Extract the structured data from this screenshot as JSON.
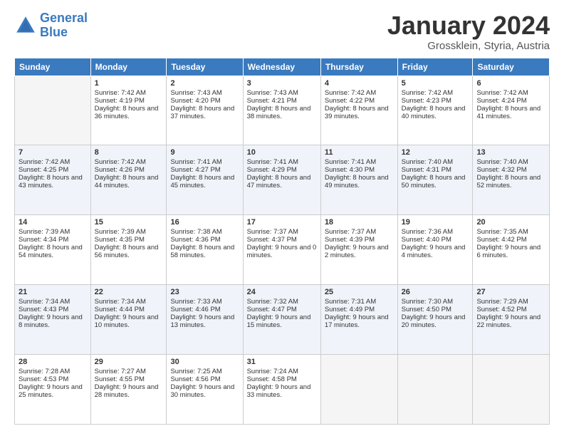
{
  "logo": {
    "line1": "General",
    "line2": "Blue"
  },
  "header": {
    "month": "January 2024",
    "location": "Grossklein, Styria, Austria"
  },
  "weekdays": [
    "Sunday",
    "Monday",
    "Tuesday",
    "Wednesday",
    "Thursday",
    "Friday",
    "Saturday"
  ],
  "weeks": [
    [
      {
        "day": "",
        "sunrise": "",
        "sunset": "",
        "daylight": ""
      },
      {
        "day": "1",
        "sunrise": "Sunrise: 7:42 AM",
        "sunset": "Sunset: 4:19 PM",
        "daylight": "Daylight: 8 hours and 36 minutes."
      },
      {
        "day": "2",
        "sunrise": "Sunrise: 7:43 AM",
        "sunset": "Sunset: 4:20 PM",
        "daylight": "Daylight: 8 hours and 37 minutes."
      },
      {
        "day": "3",
        "sunrise": "Sunrise: 7:43 AM",
        "sunset": "Sunset: 4:21 PM",
        "daylight": "Daylight: 8 hours and 38 minutes."
      },
      {
        "day": "4",
        "sunrise": "Sunrise: 7:42 AM",
        "sunset": "Sunset: 4:22 PM",
        "daylight": "Daylight: 8 hours and 39 minutes."
      },
      {
        "day": "5",
        "sunrise": "Sunrise: 7:42 AM",
        "sunset": "Sunset: 4:23 PM",
        "daylight": "Daylight: 8 hours and 40 minutes."
      },
      {
        "day": "6",
        "sunrise": "Sunrise: 7:42 AM",
        "sunset": "Sunset: 4:24 PM",
        "daylight": "Daylight: 8 hours and 41 minutes."
      }
    ],
    [
      {
        "day": "7",
        "sunrise": "Sunrise: 7:42 AM",
        "sunset": "Sunset: 4:25 PM",
        "daylight": "Daylight: 8 hours and 43 minutes."
      },
      {
        "day": "8",
        "sunrise": "Sunrise: 7:42 AM",
        "sunset": "Sunset: 4:26 PM",
        "daylight": "Daylight: 8 hours and 44 minutes."
      },
      {
        "day": "9",
        "sunrise": "Sunrise: 7:41 AM",
        "sunset": "Sunset: 4:27 PM",
        "daylight": "Daylight: 8 hours and 45 minutes."
      },
      {
        "day": "10",
        "sunrise": "Sunrise: 7:41 AM",
        "sunset": "Sunset: 4:29 PM",
        "daylight": "Daylight: 8 hours and 47 minutes."
      },
      {
        "day": "11",
        "sunrise": "Sunrise: 7:41 AM",
        "sunset": "Sunset: 4:30 PM",
        "daylight": "Daylight: 8 hours and 49 minutes."
      },
      {
        "day": "12",
        "sunrise": "Sunrise: 7:40 AM",
        "sunset": "Sunset: 4:31 PM",
        "daylight": "Daylight: 8 hours and 50 minutes."
      },
      {
        "day": "13",
        "sunrise": "Sunrise: 7:40 AM",
        "sunset": "Sunset: 4:32 PM",
        "daylight": "Daylight: 8 hours and 52 minutes."
      }
    ],
    [
      {
        "day": "14",
        "sunrise": "Sunrise: 7:39 AM",
        "sunset": "Sunset: 4:34 PM",
        "daylight": "Daylight: 8 hours and 54 minutes."
      },
      {
        "day": "15",
        "sunrise": "Sunrise: 7:39 AM",
        "sunset": "Sunset: 4:35 PM",
        "daylight": "Daylight: 8 hours and 56 minutes."
      },
      {
        "day": "16",
        "sunrise": "Sunrise: 7:38 AM",
        "sunset": "Sunset: 4:36 PM",
        "daylight": "Daylight: 8 hours and 58 minutes."
      },
      {
        "day": "17",
        "sunrise": "Sunrise: 7:37 AM",
        "sunset": "Sunset: 4:37 PM",
        "daylight": "Daylight: 9 hours and 0 minutes."
      },
      {
        "day": "18",
        "sunrise": "Sunrise: 7:37 AM",
        "sunset": "Sunset: 4:39 PM",
        "daylight": "Daylight: 9 hours and 2 minutes."
      },
      {
        "day": "19",
        "sunrise": "Sunrise: 7:36 AM",
        "sunset": "Sunset: 4:40 PM",
        "daylight": "Daylight: 9 hours and 4 minutes."
      },
      {
        "day": "20",
        "sunrise": "Sunrise: 7:35 AM",
        "sunset": "Sunset: 4:42 PM",
        "daylight": "Daylight: 9 hours and 6 minutes."
      }
    ],
    [
      {
        "day": "21",
        "sunrise": "Sunrise: 7:34 AM",
        "sunset": "Sunset: 4:43 PM",
        "daylight": "Daylight: 9 hours and 8 minutes."
      },
      {
        "day": "22",
        "sunrise": "Sunrise: 7:34 AM",
        "sunset": "Sunset: 4:44 PM",
        "daylight": "Daylight: 9 hours and 10 minutes."
      },
      {
        "day": "23",
        "sunrise": "Sunrise: 7:33 AM",
        "sunset": "Sunset: 4:46 PM",
        "daylight": "Daylight: 9 hours and 13 minutes."
      },
      {
        "day": "24",
        "sunrise": "Sunrise: 7:32 AM",
        "sunset": "Sunset: 4:47 PM",
        "daylight": "Daylight: 9 hours and 15 minutes."
      },
      {
        "day": "25",
        "sunrise": "Sunrise: 7:31 AM",
        "sunset": "Sunset: 4:49 PM",
        "daylight": "Daylight: 9 hours and 17 minutes."
      },
      {
        "day": "26",
        "sunrise": "Sunrise: 7:30 AM",
        "sunset": "Sunset: 4:50 PM",
        "daylight": "Daylight: 9 hours and 20 minutes."
      },
      {
        "day": "27",
        "sunrise": "Sunrise: 7:29 AM",
        "sunset": "Sunset: 4:52 PM",
        "daylight": "Daylight: 9 hours and 22 minutes."
      }
    ],
    [
      {
        "day": "28",
        "sunrise": "Sunrise: 7:28 AM",
        "sunset": "Sunset: 4:53 PM",
        "daylight": "Daylight: 9 hours and 25 minutes."
      },
      {
        "day": "29",
        "sunrise": "Sunrise: 7:27 AM",
        "sunset": "Sunset: 4:55 PM",
        "daylight": "Daylight: 9 hours and 28 minutes."
      },
      {
        "day": "30",
        "sunrise": "Sunrise: 7:25 AM",
        "sunset": "Sunset: 4:56 PM",
        "daylight": "Daylight: 9 hours and 30 minutes."
      },
      {
        "day": "31",
        "sunrise": "Sunrise: 7:24 AM",
        "sunset": "Sunset: 4:58 PM",
        "daylight": "Daylight: 9 hours and 33 minutes."
      },
      {
        "day": "",
        "sunrise": "",
        "sunset": "",
        "daylight": ""
      },
      {
        "day": "",
        "sunrise": "",
        "sunset": "",
        "daylight": ""
      },
      {
        "day": "",
        "sunrise": "",
        "sunset": "",
        "daylight": ""
      }
    ]
  ]
}
